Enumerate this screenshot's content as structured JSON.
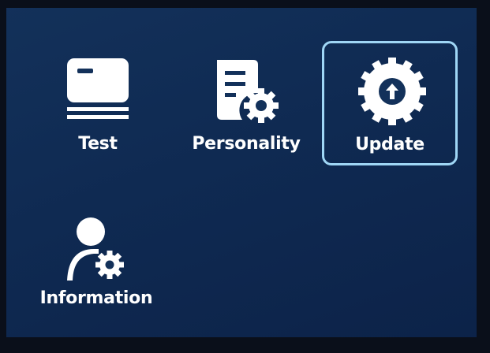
{
  "menu": {
    "items": [
      {
        "label": "Test",
        "icon": "card-icon",
        "selected": false
      },
      {
        "label": "Personality",
        "icon": "document-settings-icon",
        "selected": false
      },
      {
        "label": "Update",
        "icon": "update-arrow-icon",
        "selected": true
      },
      {
        "label": "Information",
        "icon": "user-settings-icon",
        "selected": false
      }
    ]
  },
  "colors": {
    "background": "#0f2a52",
    "icon": "#ffffff",
    "selection_border": "#9fd6f5"
  }
}
